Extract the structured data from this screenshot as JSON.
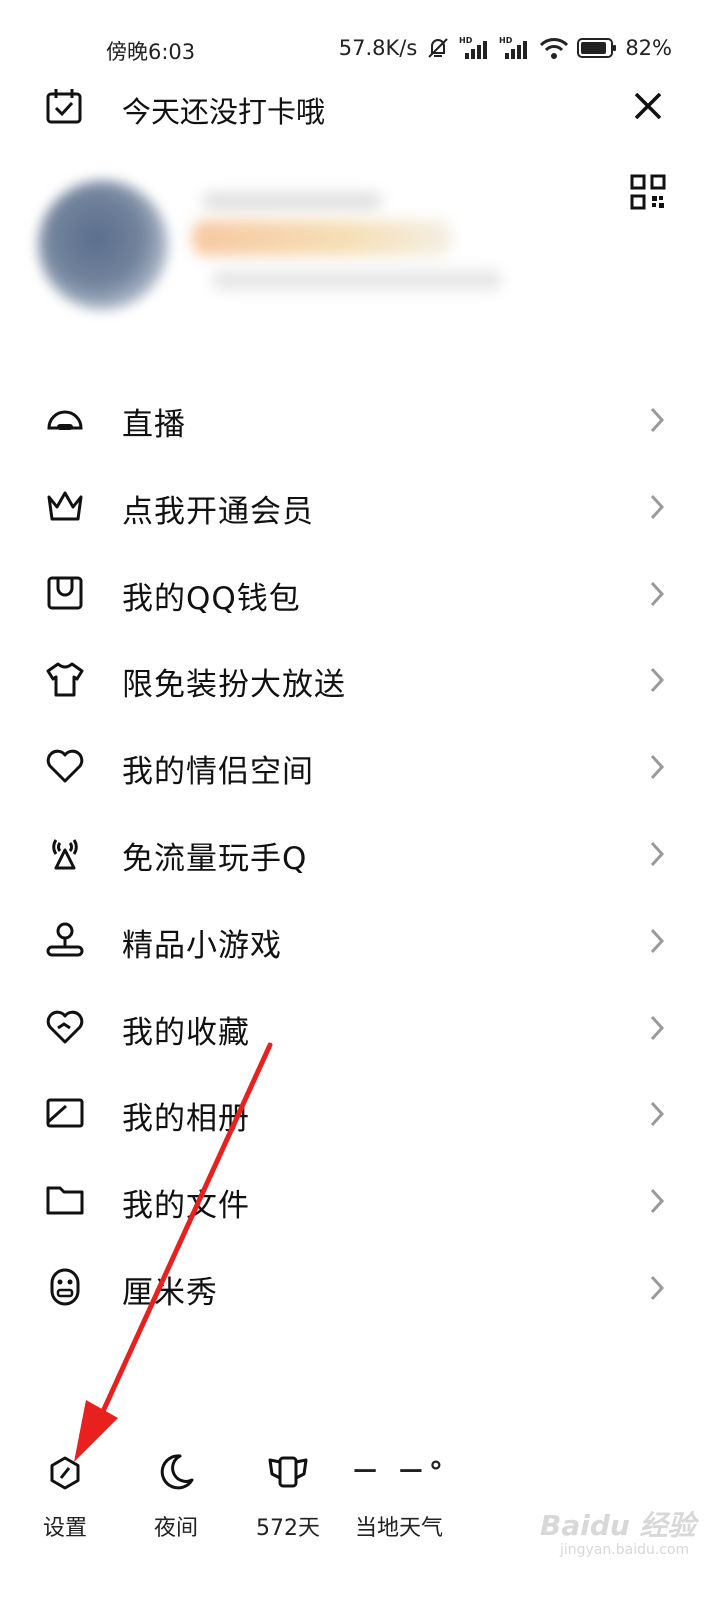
{
  "status_bar": {
    "time": "傍晚6:03",
    "speed": "57.8K/s",
    "signal_label": "HD",
    "battery": "82%"
  },
  "checkin": {
    "text": "今天还没打卡哦"
  },
  "menu": {
    "items": [
      {
        "label": "直播",
        "icon": "live-icon"
      },
      {
        "label": "点我开通会员",
        "icon": "crown-icon"
      },
      {
        "label": "我的QQ钱包",
        "icon": "wallet-icon"
      },
      {
        "label": "限免装扮大放送",
        "icon": "tshirt-icon"
      },
      {
        "label": "我的情侣空间",
        "icon": "heart-icon"
      },
      {
        "label": "免流量玩手Q",
        "icon": "antenna-icon"
      },
      {
        "label": "精品小游戏",
        "icon": "game-pin-icon"
      },
      {
        "label": "我的收藏",
        "icon": "favorite-icon"
      },
      {
        "label": "我的相册",
        "icon": "album-icon"
      },
      {
        "label": "我的文件",
        "icon": "folder-icon"
      },
      {
        "label": "厘米秀",
        "icon": "cmshow-icon"
      }
    ]
  },
  "bottom_bar": {
    "settings": "设置",
    "night": "夜间",
    "days": "572天",
    "weather_value": "－ －°",
    "weather_label": "当地天气"
  },
  "watermark": {
    "brand": "Baidu 经验",
    "url": "jingyan.baidu.com"
  },
  "colors": {
    "annotation_arrow": "#e8201e",
    "text": "#111111",
    "chevron": "#9a9a9a"
  }
}
